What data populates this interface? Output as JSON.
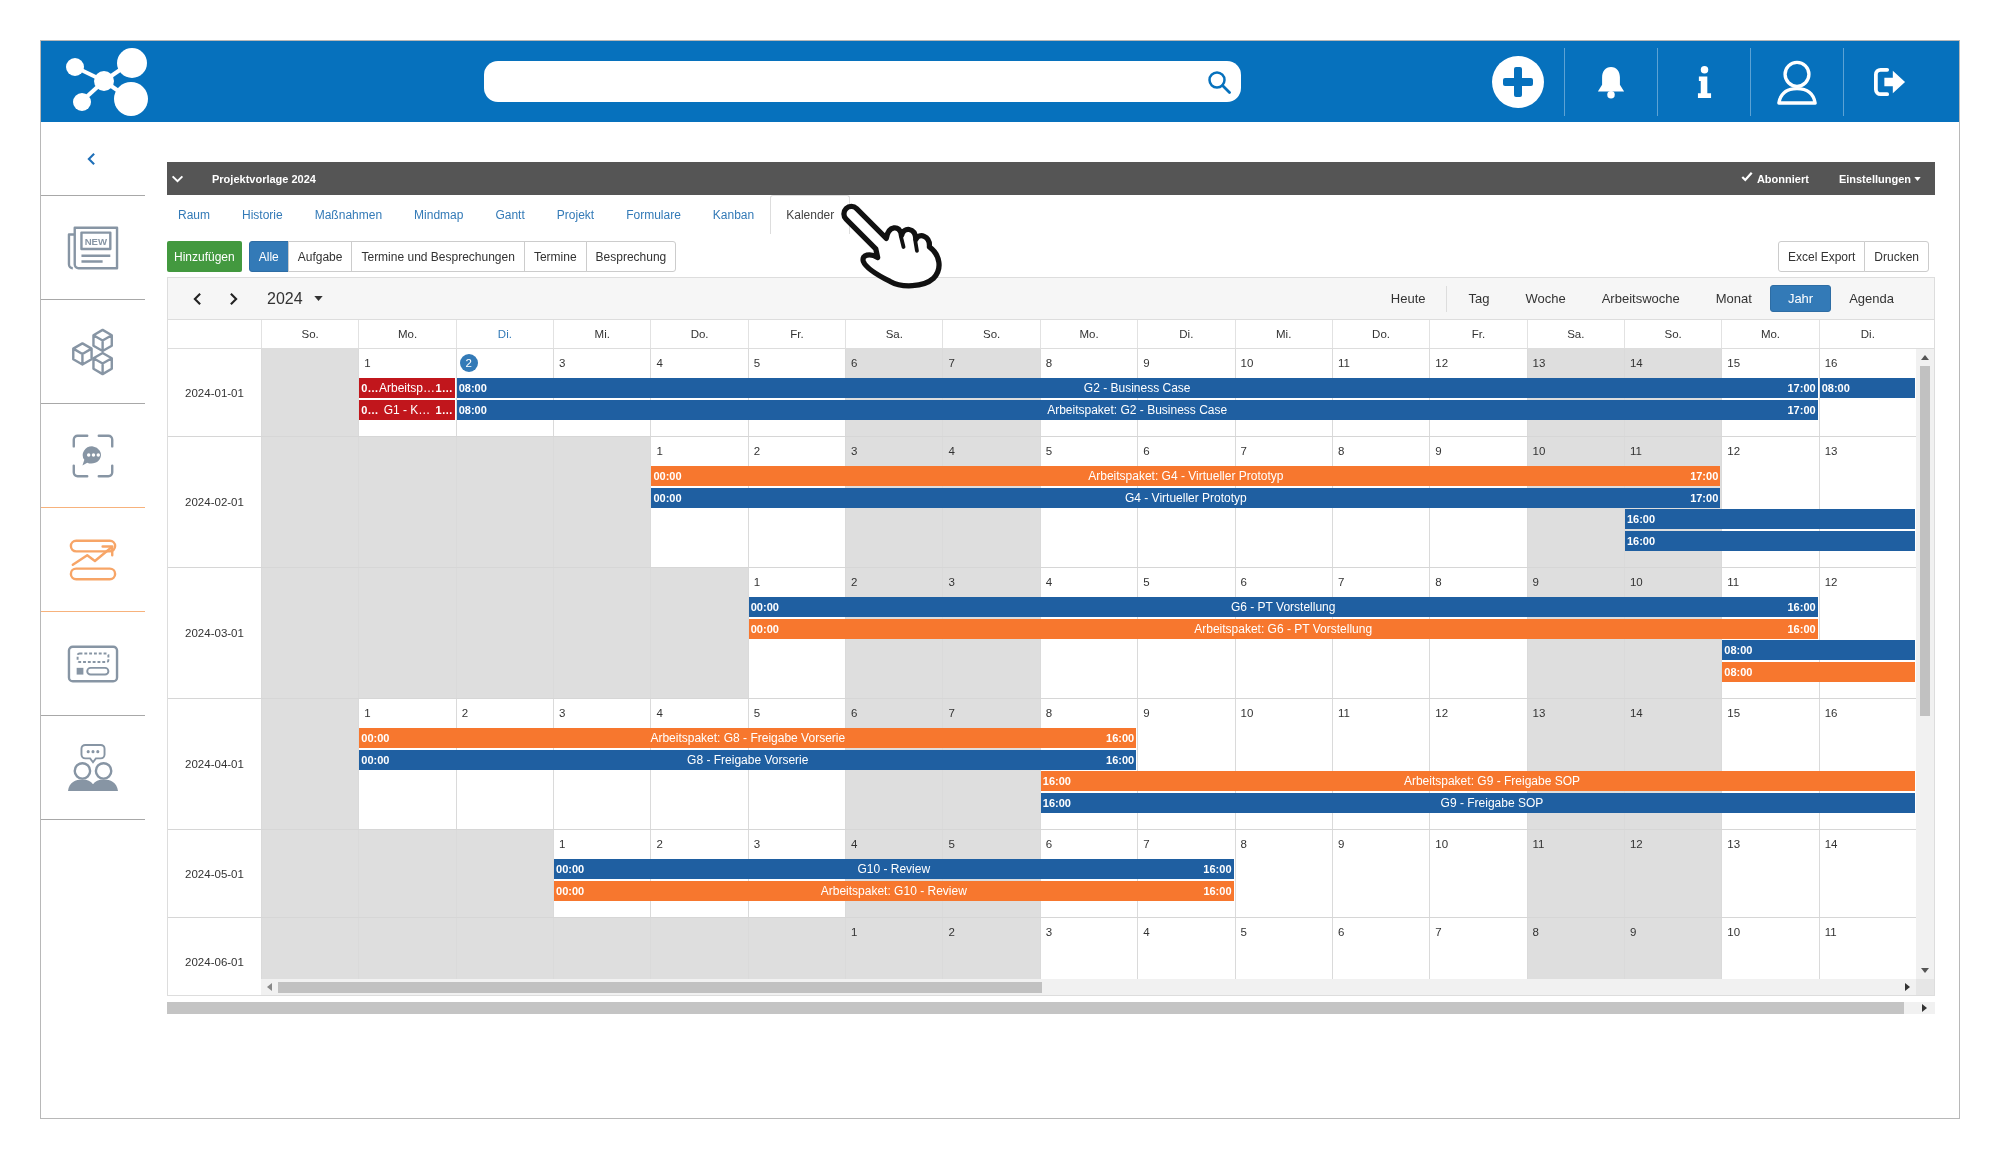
{
  "project_bar": {
    "title": "Projektvorlage 2024",
    "subscribed": {
      "label": "Abonniert",
      "checked": true
    },
    "settings": "Einstellungen"
  },
  "sidebar": {
    "items": [
      {
        "selected": false,
        "text": "NEW"
      },
      {
        "selected": false
      },
      {
        "selected": false
      },
      {
        "selected": true
      },
      {
        "selected": false
      },
      {
        "selected": false
      }
    ]
  },
  "tabs": [
    {
      "label": "Raum",
      "selected": false
    },
    {
      "label": "Historie",
      "selected": false
    },
    {
      "label": "Maßnahmen",
      "selected": false
    },
    {
      "label": "Mindmap",
      "selected": false
    },
    {
      "label": "Gantt",
      "selected": false
    },
    {
      "label": "Projekt",
      "selected": false
    },
    {
      "label": "Formulare",
      "selected": false
    },
    {
      "label": "Kanban",
      "selected": false
    },
    {
      "label": "Kalender",
      "selected": true
    }
  ],
  "toolbar": {
    "add": "Hinzufügen",
    "filters": [
      {
        "label": "Alle",
        "selected": true
      },
      {
        "label": "Aufgabe",
        "selected": false
      },
      {
        "label": "Termine und Besprechungen",
        "selected": false
      },
      {
        "label": "Termine",
        "selected": false
      },
      {
        "label": "Besprechung",
        "selected": false
      }
    ],
    "actions": [
      "Excel Export",
      "Drucken"
    ]
  },
  "calendar": {
    "year": "2024",
    "today_button": "Heute",
    "views": [
      {
        "label": "Tag",
        "selected": false
      },
      {
        "label": "Woche",
        "selected": false
      },
      {
        "label": "Arbeitswoche",
        "selected": false
      },
      {
        "label": "Monat",
        "selected": false
      },
      {
        "label": "Jahr",
        "selected": true
      },
      {
        "label": "Agenda",
        "selected": false
      }
    ],
    "columns": [
      {
        "label": "So.",
        "today": false
      },
      {
        "label": "Mo.",
        "today": false
      },
      {
        "label": "Di.",
        "today": true
      },
      {
        "label": "Mi.",
        "today": false
      },
      {
        "label": "Do.",
        "today": false
      },
      {
        "label": "Fr.",
        "today": false
      },
      {
        "label": "Sa.",
        "today": false
      },
      {
        "label": "So.",
        "today": false
      },
      {
        "label": "Mo.",
        "today": false
      },
      {
        "label": "Di.",
        "today": false
      },
      {
        "label": "Mi.",
        "today": false
      },
      {
        "label": "Do.",
        "today": false
      },
      {
        "label": "Fr.",
        "today": false
      },
      {
        "label": "Sa.",
        "today": false
      },
      {
        "label": "So.",
        "today": false
      },
      {
        "label": "Mo.",
        "today": false
      },
      {
        "label": "Di.",
        "today": false
      }
    ],
    "rows": [
      {
        "label": "2024-01-01",
        "cells": [
          {
            "shaded": true
          },
          {
            "day": "1",
            "shaded": false,
            "today": false
          },
          {
            "day": "2",
            "shaded": false,
            "today": true
          },
          {
            "day": "3",
            "shaded": false,
            "today": false
          },
          {
            "day": "4",
            "shaded": false,
            "today": false
          },
          {
            "day": "5",
            "shaded": false,
            "today": false
          },
          {
            "day": "6",
            "shaded": true,
            "today": false
          },
          {
            "day": "7",
            "shaded": true,
            "today": false
          },
          {
            "day": "8",
            "shaded": false,
            "today": false
          },
          {
            "day": "9",
            "shaded": false,
            "today": false
          },
          {
            "day": "10",
            "shaded": false,
            "today": false
          },
          {
            "day": "11",
            "shaded": false,
            "today": false
          },
          {
            "day": "12",
            "shaded": false,
            "today": false
          },
          {
            "day": "13",
            "shaded": true,
            "today": false
          },
          {
            "day": "14",
            "shaded": true,
            "today": false
          },
          {
            "day": "15",
            "shaded": false,
            "today": false
          },
          {
            "day": "16",
            "shaded": false,
            "today": false
          }
        ],
        "lanes": [
          {
            "slots": [
              {
                "kind": "empty"
              },
              {
                "kind": "event",
                "color": "#c1161c",
                "start": "0…",
                "title": "Arbeitsp…",
                "end": "1…"
              },
              {
                "kind": "event",
                "color": "#1f5fa1",
                "start": "08:00",
                "title": "G2 - Business Case",
                "end": "17:00"
              },
              {
                "kind": "continued"
              },
              {
                "kind": "continued"
              },
              {
                "kind": "continued"
              },
              {
                "kind": "continued"
              },
              {
                "kind": "continued"
              },
              {
                "kind": "continued"
              },
              {
                "kind": "continued"
              },
              {
                "kind": "continued"
              },
              {
                "kind": "continued"
              },
              {
                "kind": "continued"
              },
              {
                "kind": "continued"
              },
              {
                "kind": "continued"
              },
              {
                "kind": "continued"
              },
              {
                "kind": "event",
                "color": "#1f5fa1",
                "start": "08:00"
              }
            ]
          },
          {
            "slots": [
              {
                "kind": "empty"
              },
              {
                "kind": "event",
                "color": "#c1161c",
                "start": "0…",
                "title": "G1 - K…",
                "end": "1…"
              },
              {
                "kind": "event",
                "color": "#1f5fa1",
                "start": "08:00",
                "title": "Arbeitspaket: G2 - Business Case",
                "end": "17:00"
              },
              {
                "kind": "continued"
              },
              {
                "kind": "continued"
              },
              {
                "kind": "continued"
              },
              {
                "kind": "continued"
              },
              {
                "kind": "continued"
              },
              {
                "kind": "continued"
              },
              {
                "kind": "continued"
              },
              {
                "kind": "continued"
              },
              {
                "kind": "continued"
              },
              {
                "kind": "continued"
              },
              {
                "kind": "continued"
              },
              {
                "kind": "continued"
              },
              {
                "kind": "continued"
              },
              {
                "kind": "empty"
              }
            ]
          }
        ]
      },
      {
        "label": "2024-02-01",
        "cells": [
          {
            "shaded": true
          },
          {
            "shaded": true
          },
          {
            "shaded": true
          },
          {
            "shaded": true
          },
          {
            "day": "1",
            "shaded": false,
            "today": false
          },
          {
            "day": "2",
            "shaded": false,
            "today": false
          },
          {
            "day": "3",
            "shaded": true,
            "today": false
          },
          {
            "day": "4",
            "shaded": true,
            "today": false
          },
          {
            "day": "5",
            "shaded": false,
            "today": false
          },
          {
            "day": "6",
            "shaded": false,
            "today": false
          },
          {
            "day": "7",
            "shaded": false,
            "today": false
          },
          {
            "day": "8",
            "shaded": false,
            "today": false
          },
          {
            "day": "9",
            "shaded": false,
            "today": false
          },
          {
            "day": "10",
            "shaded": true,
            "today": false
          },
          {
            "day": "11",
            "shaded": true,
            "today": false
          },
          {
            "day": "12",
            "shaded": false,
            "today": false
          },
          {
            "day": "13",
            "shaded": false,
            "today": false
          }
        ],
        "lanes": [
          {
            "slots": [
              {
                "kind": "empty"
              },
              {
                "kind": "empty"
              },
              {
                "kind": "empty"
              },
              {
                "kind": "empty"
              },
              {
                "kind": "event",
                "color": "#f7772e",
                "start": "00:00",
                "title": "Arbeitspaket: G4 - Virtueller Prototyp",
                "end": "17:00"
              },
              {
                "kind": "continued"
              },
              {
                "kind": "continued"
              },
              {
                "kind": "continued"
              },
              {
                "kind": "continued"
              },
              {
                "kind": "continued"
              },
              {
                "kind": "continued"
              },
              {
                "kind": "continued"
              },
              {
                "kind": "continued"
              },
              {
                "kind": "continued"
              },
              {
                "kind": "continued"
              },
              {
                "kind": "empty"
              },
              {
                "kind": "empty"
              }
            ]
          },
          {
            "slots": [
              {
                "kind": "empty"
              },
              {
                "kind": "empty"
              },
              {
                "kind": "empty"
              },
              {
                "kind": "empty"
              },
              {
                "kind": "event",
                "color": "#1f5fa1",
                "start": "00:00",
                "title": "G4 - Virtueller Prototyp",
                "end": "17:00"
              },
              {
                "kind": "continued"
              },
              {
                "kind": "continued"
              },
              {
                "kind": "continued"
              },
              {
                "kind": "continued"
              },
              {
                "kind": "continued"
              },
              {
                "kind": "continued"
              },
              {
                "kind": "continued"
              },
              {
                "kind": "continued"
              },
              {
                "kind": "continued"
              },
              {
                "kind": "continued"
              },
              {
                "kind": "empty"
              },
              {
                "kind": "empty"
              }
            ]
          },
          {
            "slots": [
              {
                "kind": "empty"
              },
              {
                "kind": "empty"
              },
              {
                "kind": "empty"
              },
              {
                "kind": "empty"
              },
              {
                "kind": "empty"
              },
              {
                "kind": "empty"
              },
              {
                "kind": "empty"
              },
              {
                "kind": "empty"
              },
              {
                "kind": "empty"
              },
              {
                "kind": "empty"
              },
              {
                "kind": "empty"
              },
              {
                "kind": "empty"
              },
              {
                "kind": "empty"
              },
              {
                "kind": "empty"
              },
              {
                "kind": "event",
                "color": "#1f5fa1",
                "start": "16:00"
              },
              {
                "kind": "continued"
              },
              {
                "kind": "continued"
              }
            ]
          },
          {
            "slots": [
              {
                "kind": "empty"
              },
              {
                "kind": "empty"
              },
              {
                "kind": "empty"
              },
              {
                "kind": "empty"
              },
              {
                "kind": "empty"
              },
              {
                "kind": "empty"
              },
              {
                "kind": "empty"
              },
              {
                "kind": "empty"
              },
              {
                "kind": "empty"
              },
              {
                "kind": "empty"
              },
              {
                "kind": "empty"
              },
              {
                "kind": "empty"
              },
              {
                "kind": "empty"
              },
              {
                "kind": "empty"
              },
              {
                "kind": "event",
                "color": "#1f5fa1",
                "start": "16:00"
              },
              {
                "kind": "continued"
              },
              {
                "kind": "continued"
              }
            ]
          }
        ]
      },
      {
        "label": "2024-03-01",
        "cells": [
          {
            "shaded": true
          },
          {
            "shaded": true
          },
          {
            "shaded": true
          },
          {
            "shaded": true
          },
          {
            "shaded": true
          },
          {
            "day": "1",
            "shaded": false,
            "today": false
          },
          {
            "day": "2",
            "shaded": true,
            "today": false
          },
          {
            "day": "3",
            "shaded": true,
            "today": false
          },
          {
            "day": "4",
            "shaded": false,
            "today": false
          },
          {
            "day": "5",
            "shaded": false,
            "today": false
          },
          {
            "day": "6",
            "shaded": false,
            "today": false
          },
          {
            "day": "7",
            "shaded": false,
            "today": false
          },
          {
            "day": "8",
            "shaded": false,
            "today": false
          },
          {
            "day": "9",
            "shaded": true,
            "today": false
          },
          {
            "day": "10",
            "shaded": true,
            "today": false
          },
          {
            "day": "11",
            "shaded": false,
            "today": false
          },
          {
            "day": "12",
            "shaded": false,
            "today": false
          }
        ],
        "lanes": [
          {
            "slots": [
              {
                "kind": "empty"
              },
              {
                "kind": "empty"
              },
              {
                "kind": "empty"
              },
              {
                "kind": "empty"
              },
              {
                "kind": "empty"
              },
              {
                "kind": "event",
                "color": "#1f5fa1",
                "start": "00:00",
                "title": "G6 - PT Vorstellung",
                "end": "16:00"
              },
              {
                "kind": "continued"
              },
              {
                "kind": "continued"
              },
              {
                "kind": "continued"
              },
              {
                "kind": "continued"
              },
              {
                "kind": "continued"
              },
              {
                "kind": "continued"
              },
              {
                "kind": "continued"
              },
              {
                "kind": "continued"
              },
              {
                "kind": "continued"
              },
              {
                "kind": "continued"
              },
              {
                "kind": "empty"
              }
            ]
          },
          {
            "slots": [
              {
                "kind": "empty"
              },
              {
                "kind": "empty"
              },
              {
                "kind": "empty"
              },
              {
                "kind": "empty"
              },
              {
                "kind": "empty"
              },
              {
                "kind": "event",
                "color": "#f7772e",
                "start": "00:00",
                "title": "Arbeitspaket: G6 - PT Vorstellung",
                "end": "16:00"
              },
              {
                "kind": "continued"
              },
              {
                "kind": "continued"
              },
              {
                "kind": "continued"
              },
              {
                "kind": "continued"
              },
              {
                "kind": "continued"
              },
              {
                "kind": "continued"
              },
              {
                "kind": "continued"
              },
              {
                "kind": "continued"
              },
              {
                "kind": "continued"
              },
              {
                "kind": "continued"
              },
              {
                "kind": "empty"
              }
            ]
          },
          {
            "slots": [
              {
                "kind": "empty"
              },
              {
                "kind": "empty"
              },
              {
                "kind": "empty"
              },
              {
                "kind": "empty"
              },
              {
                "kind": "empty"
              },
              {
                "kind": "empty"
              },
              {
                "kind": "empty"
              },
              {
                "kind": "empty"
              },
              {
                "kind": "empty"
              },
              {
                "kind": "empty"
              },
              {
                "kind": "empty"
              },
              {
                "kind": "empty"
              },
              {
                "kind": "empty"
              },
              {
                "kind": "empty"
              },
              {
                "kind": "empty"
              },
              {
                "kind": "event",
                "color": "#1f5fa1",
                "start": "08:00"
              },
              {
                "kind": "continued"
              }
            ]
          },
          {
            "slots": [
              {
                "kind": "empty"
              },
              {
                "kind": "empty"
              },
              {
                "kind": "empty"
              },
              {
                "kind": "empty"
              },
              {
                "kind": "empty"
              },
              {
                "kind": "empty"
              },
              {
                "kind": "empty"
              },
              {
                "kind": "empty"
              },
              {
                "kind": "empty"
              },
              {
                "kind": "empty"
              },
              {
                "kind": "empty"
              },
              {
                "kind": "empty"
              },
              {
                "kind": "empty"
              },
              {
                "kind": "empty"
              },
              {
                "kind": "empty"
              },
              {
                "kind": "event",
                "color": "#f7772e",
                "start": "08:00"
              },
              {
                "kind": "continued"
              }
            ]
          }
        ]
      },
      {
        "label": "2024-04-01",
        "cells": [
          {
            "shaded": true
          },
          {
            "day": "1",
            "shaded": false,
            "today": false
          },
          {
            "day": "2",
            "shaded": false,
            "today": false
          },
          {
            "day": "3",
            "shaded": false,
            "today": false
          },
          {
            "day": "4",
            "shaded": false,
            "today": false
          },
          {
            "day": "5",
            "shaded": false,
            "today": false
          },
          {
            "day": "6",
            "shaded": true,
            "today": false
          },
          {
            "day": "7",
            "shaded": true,
            "today": false
          },
          {
            "day": "8",
            "shaded": false,
            "today": false
          },
          {
            "day": "9",
            "shaded": false,
            "today": false
          },
          {
            "day": "10",
            "shaded": false,
            "today": false
          },
          {
            "day": "11",
            "shaded": false,
            "today": false
          },
          {
            "day": "12",
            "shaded": false,
            "today": false
          },
          {
            "day": "13",
            "shaded": true,
            "today": false
          },
          {
            "day": "14",
            "shaded": true,
            "today": false
          },
          {
            "day": "15",
            "shaded": false,
            "today": false
          },
          {
            "day": "16",
            "shaded": false,
            "today": false
          }
        ],
        "lanes": [
          {
            "slots": [
              {
                "kind": "empty"
              },
              {
                "kind": "event",
                "color": "#f7772e",
                "start": "00:00",
                "title": "Arbeitspaket: G8 - Freigabe Vorserie",
                "end": "16:00"
              },
              {
                "kind": "continued"
              },
              {
                "kind": "continued"
              },
              {
                "kind": "continued"
              },
              {
                "kind": "continued"
              },
              {
                "kind": "continued"
              },
              {
                "kind": "continued"
              },
              {
                "kind": "continued"
              },
              {
                "kind": "empty"
              },
              {
                "kind": "empty"
              },
              {
                "kind": "empty"
              },
              {
                "kind": "empty"
              },
              {
                "kind": "empty"
              },
              {
                "kind": "empty"
              },
              {
                "kind": "empty"
              },
              {
                "kind": "empty"
              }
            ]
          },
          {
            "slots": [
              {
                "kind": "empty"
              },
              {
                "kind": "event",
                "color": "#1f5fa1",
                "start": "00:00",
                "title": "G8 - Freigabe Vorserie",
                "end": "16:00"
              },
              {
                "kind": "continued"
              },
              {
                "kind": "continued"
              },
              {
                "kind": "continued"
              },
              {
                "kind": "continued"
              },
              {
                "kind": "continued"
              },
              {
                "kind": "continued"
              },
              {
                "kind": "continued"
              },
              {
                "kind": "empty"
              },
              {
                "kind": "empty"
              },
              {
                "kind": "empty"
              },
              {
                "kind": "empty"
              },
              {
                "kind": "empty"
              },
              {
                "kind": "empty"
              },
              {
                "kind": "empty"
              },
              {
                "kind": "empty"
              }
            ]
          },
          {
            "slots": [
              {
                "kind": "empty"
              },
              {
                "kind": "empty"
              },
              {
                "kind": "empty"
              },
              {
                "kind": "empty"
              },
              {
                "kind": "empty"
              },
              {
                "kind": "empty"
              },
              {
                "kind": "empty"
              },
              {
                "kind": "empty"
              },
              {
                "kind": "event",
                "color": "#f7772e",
                "start": "16:00",
                "title": "Arbeitspaket: G9 - Freigabe SOP"
              },
              {
                "kind": "continued"
              },
              {
                "kind": "continued"
              },
              {
                "kind": "continued"
              },
              {
                "kind": "continued"
              },
              {
                "kind": "continued"
              },
              {
                "kind": "continued"
              },
              {
                "kind": "continued"
              },
              {
                "kind": "continued"
              }
            ]
          },
          {
            "slots": [
              {
                "kind": "empty"
              },
              {
                "kind": "empty"
              },
              {
                "kind": "empty"
              },
              {
                "kind": "empty"
              },
              {
                "kind": "empty"
              },
              {
                "kind": "empty"
              },
              {
                "kind": "empty"
              },
              {
                "kind": "empty"
              },
              {
                "kind": "event",
                "color": "#1f5fa1",
                "start": "16:00",
                "title": "G9 - Freigabe SOP"
              },
              {
                "kind": "continued"
              },
              {
                "kind": "continued"
              },
              {
                "kind": "continued"
              },
              {
                "kind": "continued"
              },
              {
                "kind": "continued"
              },
              {
                "kind": "continued"
              },
              {
                "kind": "continued"
              },
              {
                "kind": "continued"
              }
            ]
          }
        ]
      },
      {
        "label": "2024-05-01",
        "cells": [
          {
            "shaded": true
          },
          {
            "shaded": true
          },
          {
            "shaded": true
          },
          {
            "day": "1",
            "shaded": false,
            "today": false
          },
          {
            "day": "2",
            "shaded": false,
            "today": false
          },
          {
            "day": "3",
            "shaded": false,
            "today": false
          },
          {
            "day": "4",
            "shaded": true,
            "today": false
          },
          {
            "day": "5",
            "shaded": true,
            "today": false
          },
          {
            "day": "6",
            "shaded": false,
            "today": false
          },
          {
            "day": "7",
            "shaded": false,
            "today": false
          },
          {
            "day": "8",
            "shaded": false,
            "today": false
          },
          {
            "day": "9",
            "shaded": false,
            "today": false
          },
          {
            "day": "10",
            "shaded": false,
            "today": false
          },
          {
            "day": "11",
            "shaded": true,
            "today": false
          },
          {
            "day": "12",
            "shaded": true,
            "today": false
          },
          {
            "day": "13",
            "shaded": false,
            "today": false
          },
          {
            "day": "14",
            "shaded": false,
            "today": false
          }
        ],
        "lanes": [
          {
            "slots": [
              {
                "kind": "empty"
              },
              {
                "kind": "empty"
              },
              {
                "kind": "empty"
              },
              {
                "kind": "event",
                "color": "#1f5fa1",
                "start": "00:00",
                "title": "G10 - Review",
                "end": "16:00"
              },
              {
                "kind": "continued"
              },
              {
                "kind": "continued"
              },
              {
                "kind": "continued"
              },
              {
                "kind": "continued"
              },
              {
                "kind": "continued"
              },
              {
                "kind": "continued"
              },
              {
                "kind": "empty"
              },
              {
                "kind": "empty"
              },
              {
                "kind": "empty"
              },
              {
                "kind": "empty"
              },
              {
                "kind": "empty"
              },
              {
                "kind": "empty"
              },
              {
                "kind": "empty"
              }
            ]
          },
          {
            "slots": [
              {
                "kind": "empty"
              },
              {
                "kind": "empty"
              },
              {
                "kind": "empty"
              },
              {
                "kind": "event",
                "color": "#f7772e",
                "start": "00:00",
                "title": "Arbeitspaket: G10 - Review",
                "end": "16:00"
              },
              {
                "kind": "continued"
              },
              {
                "kind": "continued"
              },
              {
                "kind": "continued"
              },
              {
                "kind": "continued"
              },
              {
                "kind": "continued"
              },
              {
                "kind": "continued"
              },
              {
                "kind": "empty"
              },
              {
                "kind": "empty"
              },
              {
                "kind": "empty"
              },
              {
                "kind": "empty"
              },
              {
                "kind": "empty"
              },
              {
                "kind": "empty"
              },
              {
                "kind": "empty"
              }
            ]
          }
        ]
      },
      {
        "label": "2024-06-01",
        "cells": [
          {
            "shaded": true
          },
          {
            "shaded": true
          },
          {
            "shaded": true
          },
          {
            "shaded": true
          },
          {
            "shaded": true
          },
          {
            "shaded": true
          },
          {
            "day": "1",
            "shaded": true,
            "today": false
          },
          {
            "day": "2",
            "shaded": true,
            "today": false
          },
          {
            "day": "3",
            "shaded": false,
            "today": false
          },
          {
            "day": "4",
            "shaded": false,
            "today": false
          },
          {
            "day": "5",
            "shaded": false,
            "today": false
          },
          {
            "day": "6",
            "shaded": false,
            "today": false
          },
          {
            "day": "7",
            "shaded": false,
            "today": false
          },
          {
            "day": "8",
            "shaded": true,
            "today": false
          },
          {
            "day": "9",
            "shaded": true,
            "today": false
          },
          {
            "day": "10",
            "shaded": false,
            "today": false
          },
          {
            "day": "11",
            "shaded": false,
            "today": false
          }
        ]
      }
    ]
  }
}
